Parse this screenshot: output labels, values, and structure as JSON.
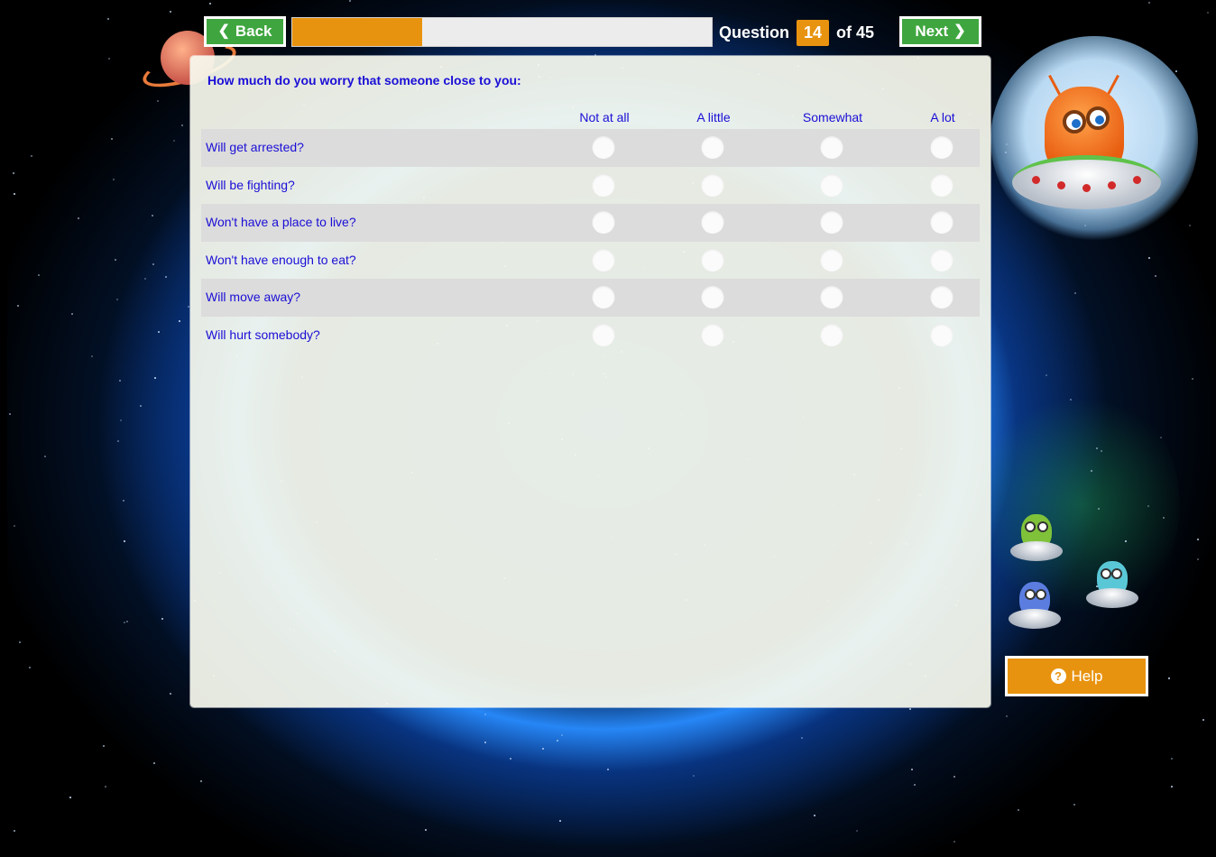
{
  "nav": {
    "back_label": "Back",
    "next_label": "Next",
    "progress_fraction": 0.31,
    "question_word": "Question",
    "question_number": "14",
    "question_total": "of 45"
  },
  "survey": {
    "prompt": "How much do you worry that someone close to you:",
    "columns": [
      "Not at all",
      "A little",
      "Somewhat",
      "A lot"
    ],
    "items": [
      "Will get arrested?",
      "Will be fighting?",
      "Won't have a place to live?",
      "Won't have enough to eat?",
      "Will move away?",
      "Will hurt somebody?"
    ]
  },
  "help": {
    "label": "Help",
    "icon": "question-circle-icon"
  },
  "colors": {
    "nav_green": "#3fa63f",
    "accent_orange": "#e8930f",
    "text_blue": "#1a0ed6"
  }
}
